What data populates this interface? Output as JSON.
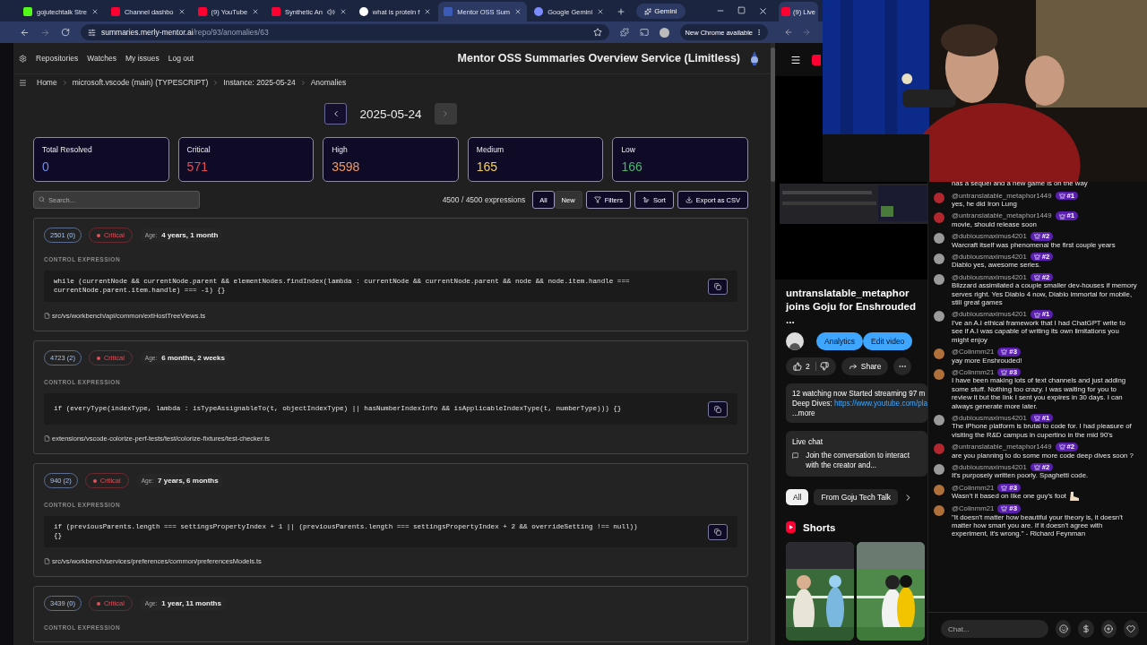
{
  "left_browser": {
    "tabs": [
      {
        "label": "gojutechtalk Stre",
        "kind": "kick",
        "selected": false,
        "audio": false
      },
      {
        "label": "Channel dashbo",
        "kind": "youtube",
        "selected": false,
        "audio": false
      },
      {
        "label": "(9) YouTube",
        "kind": "youtube",
        "selected": false,
        "audio": false
      },
      {
        "label": "Synthetic An",
        "kind": "youtube",
        "selected": false,
        "audio": true
      },
      {
        "label": "what is protein f",
        "kind": "google",
        "selected": false,
        "audio": false
      },
      {
        "label": "Mentor OSS Sum",
        "kind": "mentor",
        "selected": true,
        "audio": false
      },
      {
        "label": "Google Gemini",
        "kind": "gemini",
        "selected": false,
        "audio": false
      }
    ],
    "gemini_button": "Gemini",
    "address": {
      "host": "summaries.merly-mentor.ai",
      "path": "/repo/93/anomalies/63"
    },
    "update_button": "New Chrome available"
  },
  "app": {
    "nav": [
      "Repositories",
      "Watches",
      "My issues",
      "Log out"
    ],
    "title": "Mentor OSS Summaries Overview Service (Limitless)",
    "breadcrumb": [
      "Home",
      "microsoft.vscode (main) (TYPESCRIPT)",
      "Instance: 2025-05-24",
      "Anomalies"
    ],
    "date_nav": {
      "date": "2025-05-24",
      "prev_disabled": false,
      "next_disabled": true
    },
    "stats": [
      {
        "label": "Total Resolved",
        "value": "0",
        "color": "#6f8fe8"
      },
      {
        "label": "Critical",
        "value": "571",
        "color": "#e0505a"
      },
      {
        "label": "High",
        "value": "3598",
        "color": "#ee9a5c"
      },
      {
        "label": "Medium",
        "value": "165",
        "color": "#f2cf5b"
      },
      {
        "label": "Low",
        "value": "166",
        "color": "#4fb36f"
      }
    ],
    "search": {
      "placeholder": "Search..."
    },
    "count": "4500 / 4500 expressions",
    "filter_tabs": [
      {
        "label": "All",
        "selected": true
      },
      {
        "label": "New",
        "selected": false
      }
    ],
    "actions": [
      {
        "label": "Filters",
        "kind": "filter"
      },
      {
        "label": "Sort",
        "kind": "sort"
      },
      {
        "label": "Export as CSV",
        "kind": "export"
      }
    ],
    "anomalies": [
      {
        "id": "2501 (0)",
        "severity": "Critical",
        "age_label": "Age:",
        "age": "4 years, 1 month",
        "section": "CONTROL EXPRESSION",
        "code": "while (currentNode && currentNode.parent && elementNodes.findIndex(lambda : currentNode && currentNode.parent && node && node.item.handle === currentNode.parent.item.handle) === -1) {}",
        "path": "src/vs/workbench/api/common/extHostTreeViews.ts"
      },
      {
        "id": "4723 (2)",
        "severity": "Critical",
        "age_label": "Age:",
        "age": "6 months, 2 weeks",
        "section": "CONTROL EXPRESSION",
        "code": "if (everyType(indexType, lambda : isTypeAssignableTo(t, objectIndexType) || hasNumberIndexInfo && isApplicableIndexType(t, numberType))) {}",
        "path": "extensions/vscode-colorize-perf-tests/test/colorize-fixtures/test-checker.ts"
      },
      {
        "id": "940 (2)",
        "severity": "Critical",
        "age_label": "Age:",
        "age": "7 years, 6 months",
        "section": "CONTROL EXPRESSION",
        "code": "if (previousParents.length === settingsPropertyIndex + 1 || (previousParents.length === settingsPropertyIndex + 2 && overrideSetting !== null)) {}",
        "path": "src/vs/workbench/services/preferences/common/preferencesModels.ts"
      },
      {
        "id": "3439 (0)",
        "severity": "Critical",
        "age_label": "Age:",
        "age": "1 year, 11 months",
        "section": "CONTROL EXPRESSION"
      }
    ]
  },
  "right_browser": {
    "tab": "(9) Live",
    "video": {
      "title": "untranslatable_metaphor joins Goju for Enshrouded ...",
      "buttons": [
        "Analytics",
        "Edit video"
      ],
      "likes": "2",
      "share": "Share",
      "description": {
        "line": "12 watching now  Started streaming 97 m",
        "prefix": "Deep Dives: ",
        "link": "https://www.youtube.com/pla",
        "more": "...more"
      },
      "live_chat": {
        "title": "Live chat",
        "text": "Join the conversation to interact with the creator and..."
      },
      "chips": [
        {
          "label": "All",
          "selected": true
        },
        {
          "label": "From Goju Tech Talk",
          "selected": false
        }
      ],
      "shorts_title": "Shorts"
    },
    "chat": {
      "messages": [
        {
          "kind": "fragment",
          "text": "has a sequel and a new game is on the way"
        },
        {
          "kind": "message",
          "author": "@untranslatable_metaphor1449",
          "badge": "#1",
          "color": "#b3262e",
          "text": "yes, he did Iron Lung"
        },
        {
          "kind": "message",
          "author": "@untranslatable_metaphor1449",
          "badge": "#1",
          "color": "#b3262e",
          "text": "movie, should release soon"
        },
        {
          "kind": "message",
          "author": "@dubiousmaximus4201",
          "badge": "#2",
          "color": "#9a9a9a",
          "text": "Warcraft itself was phenomenal the first couple years"
        },
        {
          "kind": "message",
          "author": "@dubiousmaximus4201",
          "badge": "#2",
          "color": "#9a9a9a",
          "text": "Diablo yes, awesome series."
        },
        {
          "kind": "message",
          "author": "@dubiousmaximus4201",
          "badge": "#2",
          "color": "#9a9a9a",
          "text": "Blizzard assimilated a couple smaller dev-houses if memory serves right. Yes Diablo 4 now, Diablo immortal for mobile, still great games"
        },
        {
          "kind": "message",
          "author": "@dubiousmaximus4201",
          "badge": "#1",
          "color": "#9a9a9a",
          "text": "I've an A.I ethical framework that I had ChatGPT write to see if A.I was capable of writing its own limitations you might enjoy"
        },
        {
          "kind": "message",
          "author": "@Colinmm21",
          "badge": "#3",
          "color": "#b0703a",
          "text": "yay more Enshrouded!"
        },
        {
          "kind": "message",
          "author": "@Colinmm21",
          "badge": "#3",
          "color": "#b0703a",
          "text": "I have been making lots of text channels and just adding some stuff. Nothing too crazy. I was waiting for you to review it but the link I sent you expires in 30 days. I can always generate more later."
        },
        {
          "kind": "message",
          "author": "@dubiousmaximus4201",
          "badge": "#1",
          "color": "#9a9a9a",
          "text": "The iPhone platform is brutal to code for. I had pleasure of visiting the R&D campus in cupertino in the mid 90's"
        },
        {
          "kind": "message",
          "author": "@untranslatable_metaphor1449",
          "badge": "#2",
          "color": "#b3262e",
          "text": "are you planning to do some more code deep dives soon ?"
        },
        {
          "kind": "message",
          "author": "@dubiousmaximus4201",
          "badge": "#2",
          "color": "#9a9a9a",
          "text": "It's purposely written poorly. Spaghetti code."
        },
        {
          "kind": "foot_emoji_message",
          "author": "@Colinmm21",
          "badge": "#3",
          "color": "#b0703a",
          "text": "Wasn't it based on like one guy's foot"
        },
        {
          "kind": "message",
          "author": "@Colinmm21",
          "badge": "#3",
          "color": "#b0703a",
          "text": "\"It doesn't matter how beautiful your theory is, it doesn't matter how smart you are. If it doesn't agree with experiment, it's wrong.\" - Richard Feynman"
        }
      ],
      "input": {
        "placeholder": "Chat..."
      }
    }
  }
}
